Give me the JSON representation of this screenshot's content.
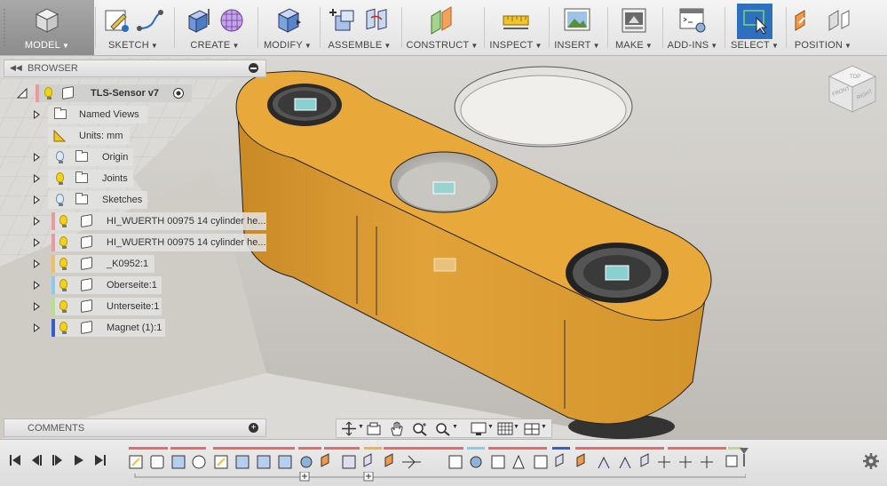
{
  "toolbar": {
    "groups": [
      {
        "id": "model",
        "label": "MODEL"
      },
      {
        "id": "sketch",
        "label": "SKETCH"
      },
      {
        "id": "create",
        "label": "CREATE"
      },
      {
        "id": "modify",
        "label": "MODIFY"
      },
      {
        "id": "assemble",
        "label": "ASSEMBLE"
      },
      {
        "id": "construct",
        "label": "CONSTRUCT"
      },
      {
        "id": "inspect",
        "label": "INSPECT"
      },
      {
        "id": "insert",
        "label": "INSERT"
      },
      {
        "id": "make",
        "label": "MAKE"
      },
      {
        "id": "addins",
        "label": "ADD-INS"
      },
      {
        "id": "select",
        "label": "SELECT"
      },
      {
        "id": "position",
        "label": "POSITION"
      }
    ],
    "caret": "▼"
  },
  "browser": {
    "title": "BROWSER",
    "root": {
      "label": "TLS-Sensor v7"
    },
    "items": [
      {
        "label": "Named Views",
        "kind": "folder"
      },
      {
        "label": "Units: mm",
        "kind": "units"
      },
      {
        "label": "Origin",
        "kind": "folder"
      },
      {
        "label": "Joints",
        "kind": "folder"
      },
      {
        "label": "Sketches",
        "kind": "folder"
      },
      {
        "label": "HI_WUERTH 00975 14 cylinder he...",
        "kind": "body",
        "tab_color": "#e89aa0"
      },
      {
        "label": "HI_WUERTH 00975 14 cylinder he...",
        "kind": "body",
        "tab_color": "#e89aa0"
      },
      {
        "label": "_K0952:1",
        "kind": "body",
        "tab_color": "#f0c060"
      },
      {
        "label": "Oberseite:1",
        "kind": "body",
        "tab_color": "#8ec8ec"
      },
      {
        "label": "Unterseite:1",
        "kind": "body",
        "tab_color": "#b5e08a"
      },
      {
        "label": "Magnet (1):1",
        "kind": "body",
        "tab_color": "#3a5ec8"
      }
    ]
  },
  "comments": {
    "title": "COMMENTS",
    "add": "+"
  },
  "viewcube": {
    "faces": [
      "TOP",
      "FRONT",
      "RIGHT"
    ]
  },
  "colors": {
    "part": "#e8a83a",
    "part_side": "#d4952b",
    "select_blue": "#2e6fc0",
    "floor": "#c9c6c0"
  }
}
